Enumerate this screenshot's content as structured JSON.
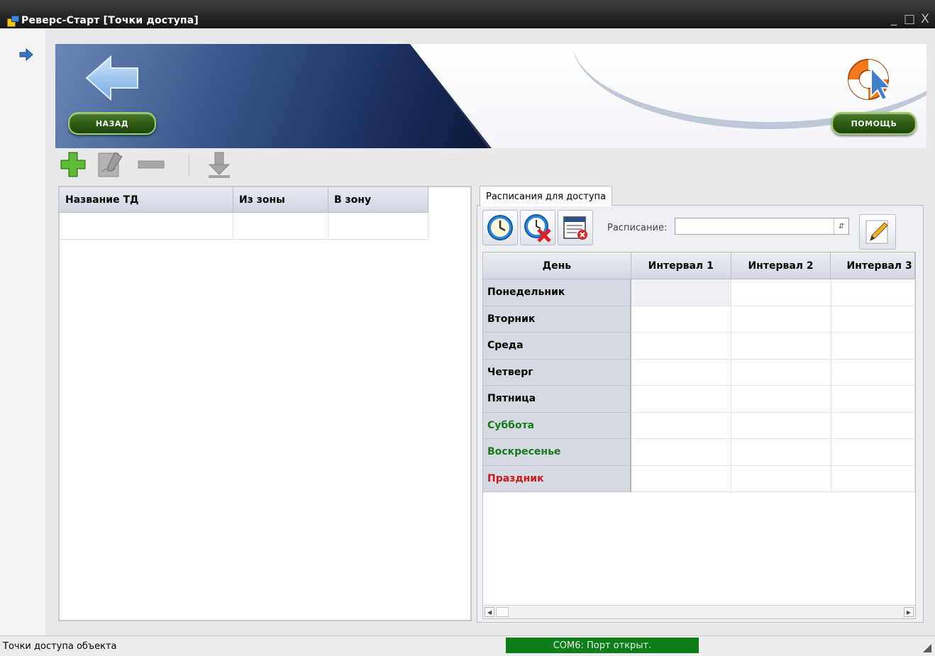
{
  "window": {
    "title": "Реверс-Старт [Точки доступа]",
    "controls": [
      "_",
      "□",
      "X"
    ]
  },
  "banner": {
    "back_label": "НАЗАД",
    "help_label": "ПОМОЩЬ"
  },
  "toolbar": {
    "icons": [
      "add-icon",
      "edit-icon",
      "remove-icon",
      "download-icon"
    ]
  },
  "access_points": {
    "columns": [
      "Название ТД",
      "Из зоны",
      "В зону"
    ],
    "rows": [
      [
        "",
        "",
        ""
      ]
    ]
  },
  "schedule": {
    "tab_label": "Расписания для доступа",
    "schedule_label": "Расписание:",
    "schedule_value": "",
    "columns": [
      "День",
      "Интервал 1",
      "Интервал 2",
      "Интервал 3"
    ],
    "days": [
      {
        "name": "Понедельник",
        "color": "#000000"
      },
      {
        "name": "Вторник",
        "color": "#000000"
      },
      {
        "name": "Среда",
        "color": "#000000"
      },
      {
        "name": "Четверг",
        "color": "#000000"
      },
      {
        "name": "Пятница",
        "color": "#000000"
      },
      {
        "name": "Суббота",
        "color": "#1a7a1a"
      },
      {
        "name": "Воскресенье",
        "color": "#1a7a1a"
      },
      {
        "name": "Праздник",
        "color": "#d01818"
      }
    ]
  },
  "status": {
    "text": "Точки доступа объекта",
    "port": "COM6: Порт открыт.",
    "port_color": "#0c7d18"
  }
}
